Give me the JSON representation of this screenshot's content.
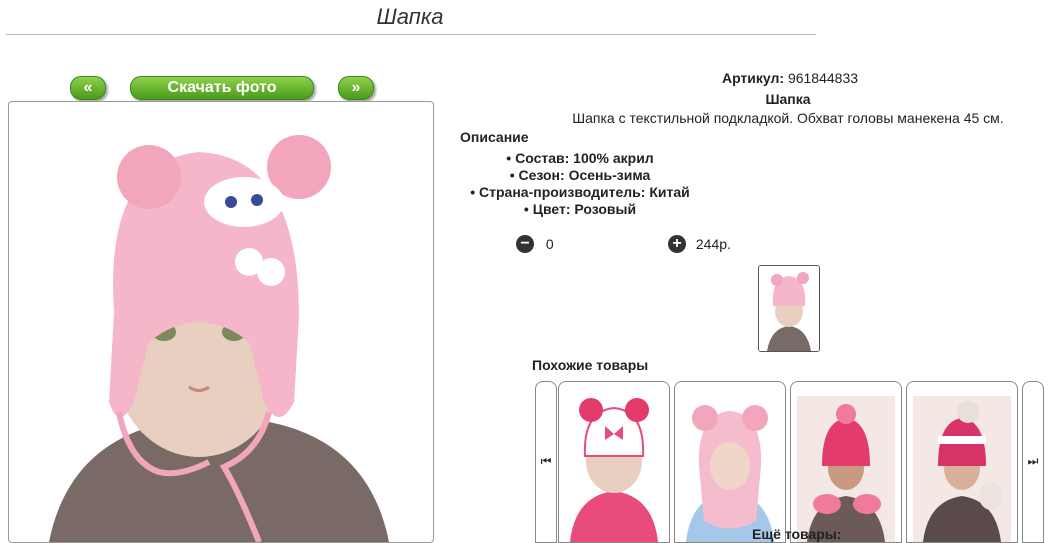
{
  "page": {
    "title": "Шапка"
  },
  "photo_nav": {
    "prev_label": "«",
    "download_label": "Скачать фото",
    "next_label": "»"
  },
  "product": {
    "article_label": "Артикул:",
    "article_value": "961844833",
    "name": "Шапка",
    "short_desc": "Шапка с текстильной подкладкой. Обхват головы манекена 45 см.",
    "description_title": "Описание",
    "features": [
      "Состав: 100% акрил",
      "Сезон: Осень-зима",
      "Страна-производитель: Китай",
      "Цвет: Розовый"
    ],
    "quantity": "0",
    "price": "244р."
  },
  "similar": {
    "title": "Похожие товары",
    "prev_icon": "first-arrow-icon",
    "next_icon": "last-arrow-icon",
    "more_title": "Ещё товары:"
  },
  "colors": {
    "accent_green": "#5aad24",
    "hat_pink": "#f4b6c8"
  }
}
